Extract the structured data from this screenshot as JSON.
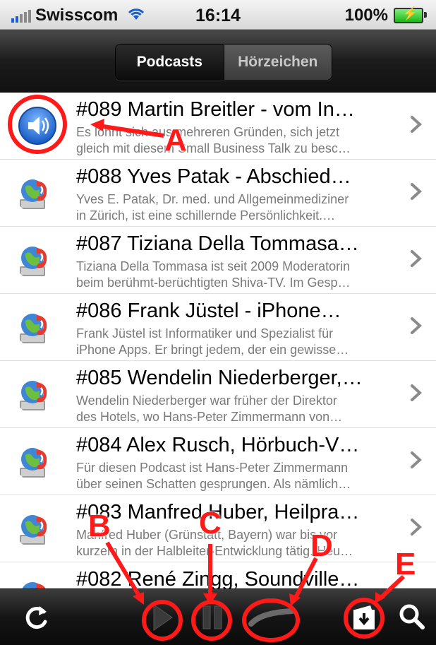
{
  "status_bar": {
    "carrier": "Swisscom",
    "time": "16:14",
    "battery": "100%"
  },
  "segmented": {
    "active": "Podcasts",
    "inactive": "Hörzeichen"
  },
  "episodes": [
    {
      "title": "#089 Martin Breitler - vom In…",
      "line1": "Es lohnt sich aus mehreren Gründen, sich jetzt",
      "line2": "gleich mit diesem Small Business Talk zu besc…",
      "icon": "speaker-icon"
    },
    {
      "title": "#088 Yves Patak - Abschied…",
      "line1": "Yves E. Patak, Dr. med. und Allgemeinmediziner",
      "line2": "in Zürich, ist eine schillernde Persönlichkeit.…",
      "icon": "podcast-globe-icon"
    },
    {
      "title": "#087 Tiziana Della Tommasa…",
      "line1": "Tiziana Della Tommasa ist seit 2009 Moderatorin",
      "line2": "beim berühmt-berüchtigten Shiva-TV. Im Gesp…",
      "icon": "podcast-globe-icon"
    },
    {
      "title": "#086 Frank Jüstel - iPhone…",
      "line1": "Frank Jüstel ist Informatiker und Spezialist für",
      "line2": "iPhone Apps. Er bringt jedem, der ein gewisse…",
      "icon": "podcast-globe-icon"
    },
    {
      "title": "#085 Wendelin Niederberger,…",
      "line1": "Wendelin Niederberger war früher der Direktor",
      "line2": "des Hotels, wo Hans-Peter Zimmermann von…",
      "icon": "podcast-globe-icon"
    },
    {
      "title": "#084 Alex Rusch, Hörbuch-V…",
      "line1": "Für diesen Podcast ist Hans-Peter Zimmermann",
      "line2": "über seinen Schatten gesprungen. Als nämlich…",
      "icon": "podcast-globe-icon"
    },
    {
      "title": "#083 Manfred Huber, Heilpra…",
      "line1": "Manfred Huber (Grünstätt, Bayern) war bis vor",
      "line2": "kurzem in der Halbleiter-Entwicklung tätig. Heu…",
      "icon": "podcast-globe-icon"
    },
    {
      "title": "#082 René Zingg, Soundville…",
      "line1": "",
      "line2": "",
      "icon": "podcast-globe-icon"
    }
  ],
  "toolbar": {
    "refresh": "refresh-icon",
    "play": "play-icon",
    "pause": "pause-icon",
    "progress": "progress-bar",
    "import": "import-icon",
    "search": "search-icon"
  },
  "annotations": {
    "a": "A",
    "b": "B",
    "c": "C",
    "d": "D",
    "e": "E"
  },
  "colors": {
    "annotation": "#ff1a1a",
    "bar_dark": "#111111",
    "desc_text": "#7a7a7a"
  }
}
